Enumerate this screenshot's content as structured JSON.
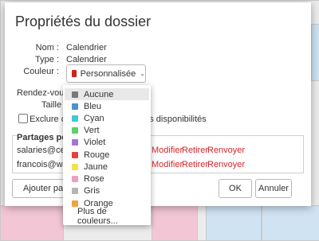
{
  "dialog": {
    "title": "Propriétés du dossier",
    "nom_label": "Nom :",
    "nom_value": "Calendrier",
    "type_label": "Type :",
    "type_value": "Calendrier",
    "couleur_label": "Couleur :",
    "couleur_value": "Personnalisée",
    "rdv_label": "Rendez-vous:",
    "taille_label": "Taille :",
    "exclude_prefix": "Exclure ce c",
    "exclude_suffix": "des disponibilités",
    "shares_title": "Partages pour",
    "shares": [
      {
        "email": "salaries@cem",
        "modify": "Modifier",
        "remove": "Retirer",
        "resend": "Renvoyer"
      },
      {
        "email": "francois@web",
        "modify": "Modifier",
        "remove": "Retirer",
        "resend": "Renvoyer"
      }
    ],
    "add_share_label": "Ajouter parta",
    "ok_label": "OK",
    "cancel_label": "Annuler"
  },
  "color_menu": {
    "items": [
      {
        "label": "Aucune",
        "color": "#777777",
        "selected": true
      },
      {
        "label": "Bleu",
        "color": "#4a90d9"
      },
      {
        "label": "Cyan",
        "color": "#3fc9d6"
      },
      {
        "label": "Vert",
        "color": "#5ad16b"
      },
      {
        "label": "Violet",
        "color": "#9b7ad8"
      },
      {
        "label": "Rouge",
        "color": "#e0463f"
      },
      {
        "label": "Jaune",
        "color": "#f2e14c"
      },
      {
        "label": "Rose",
        "color": "#ee9fc0"
      },
      {
        "label": "Gris",
        "color": "#b5b5b5"
      },
      {
        "label": "Orange",
        "color": "#f4a23c"
      }
    ],
    "more_label": "Plus de couleurs..."
  },
  "colors": {
    "accent_red": "#d3262a",
    "chevron_blue": "#2a6cb0"
  }
}
